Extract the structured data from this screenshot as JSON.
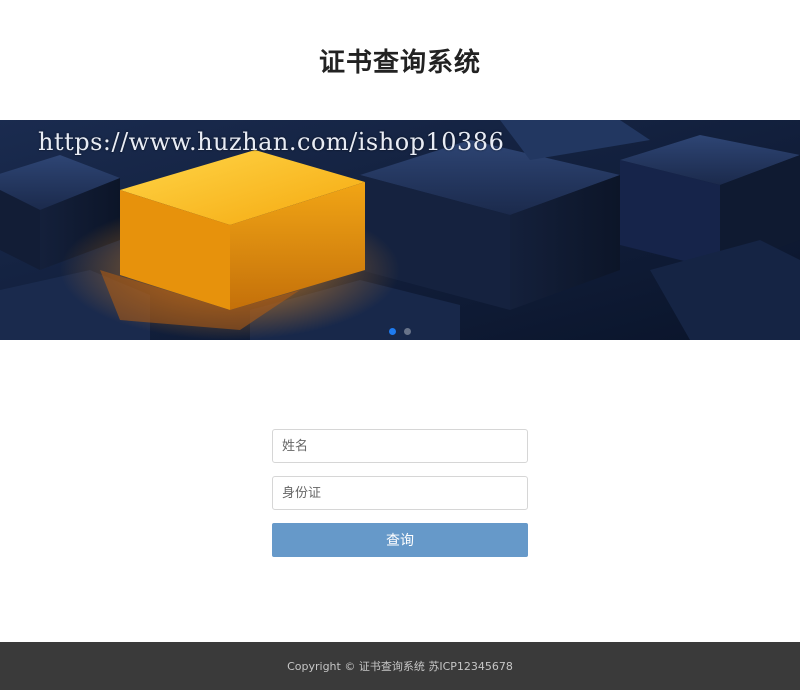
{
  "header": {
    "title": "证书查询系统"
  },
  "banner": {
    "watermark": "https://www.huzhan.com/ishop10386",
    "slides_count": 2,
    "active_slide": 1,
    "colors": {
      "background": "#0e1a33",
      "cube_accent": "#f7b521",
      "indicator_active": "#1e7bf0"
    }
  },
  "form": {
    "name_placeholder": "姓名",
    "id_placeholder": "身份证",
    "submit_label": "查询",
    "button_color": "#6699c9"
  },
  "footer": {
    "text": "Copyright © 证书查询系统 苏ICP12345678"
  }
}
